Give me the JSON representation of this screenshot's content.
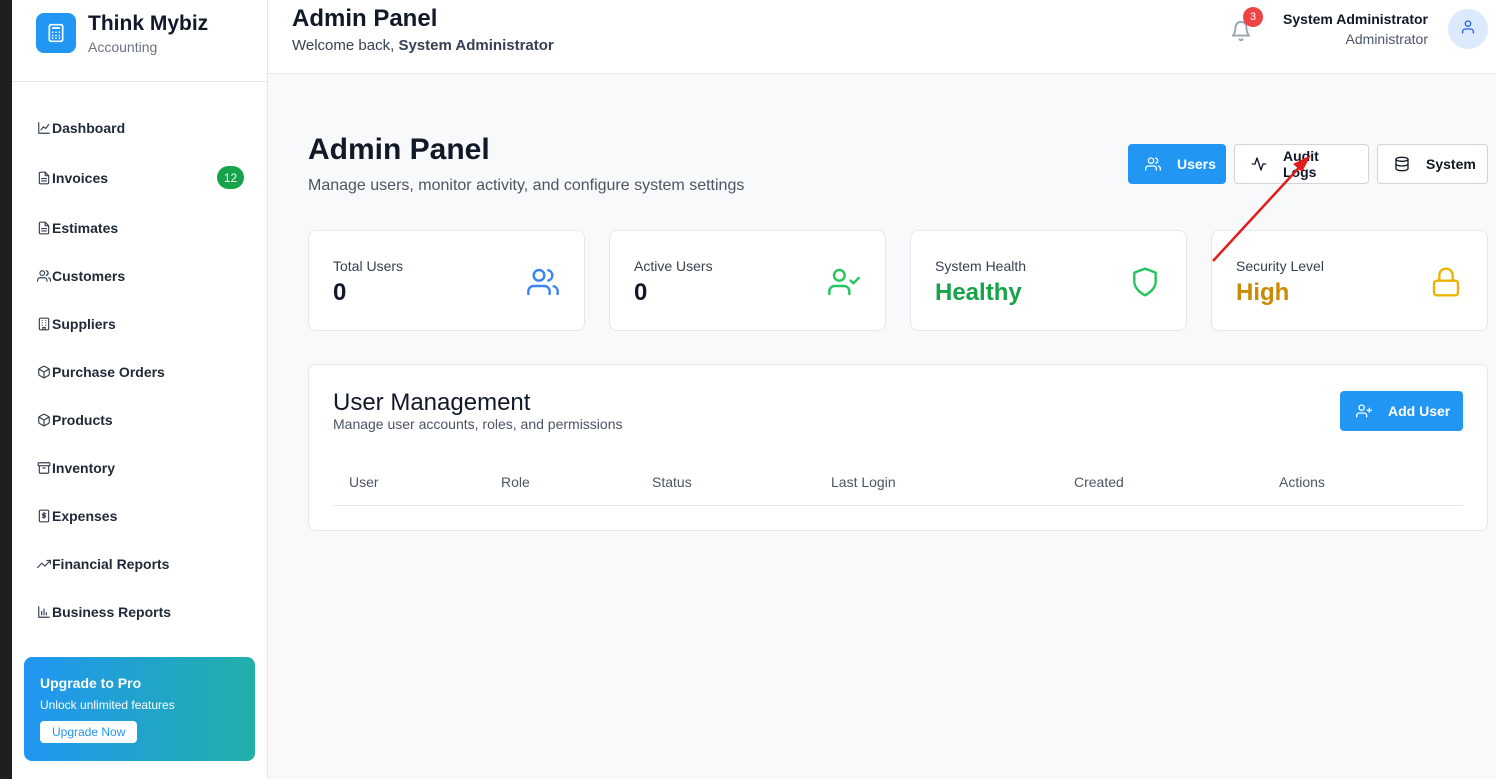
{
  "brand": {
    "name": "Think Mybiz",
    "subtitle": "Accounting"
  },
  "sidebar": {
    "items": [
      {
        "label": "Dashboard",
        "icon": "line-chart-icon"
      },
      {
        "label": "Invoices",
        "icon": "file-text-icon",
        "badge": "12"
      },
      {
        "label": "Estimates",
        "icon": "file-text-icon"
      },
      {
        "label": "Customers",
        "icon": "users-icon"
      },
      {
        "label": "Suppliers",
        "icon": "building-icon"
      },
      {
        "label": "Purchase Orders",
        "icon": "package-icon"
      },
      {
        "label": "Products",
        "icon": "package-icon"
      },
      {
        "label": "Inventory",
        "icon": "archive-icon"
      },
      {
        "label": "Expenses",
        "icon": "dollar-receipt-icon"
      },
      {
        "label": "Financial Reports",
        "icon": "trending-up-icon"
      },
      {
        "label": "Business Reports",
        "icon": "bar-chart-icon"
      }
    ],
    "upgrade": {
      "title": "Upgrade to Pro",
      "subtitle": "Unlock unlimited features",
      "button": "Upgrade Now"
    }
  },
  "header": {
    "title": "Admin Panel",
    "welcome_prefix": "Welcome back,",
    "welcome_name": "System Administrator",
    "notifications_count": "3",
    "user_name": "System Administrator",
    "user_role": "Administrator"
  },
  "main": {
    "title": "Admin Panel",
    "subtitle": "Manage users, monitor activity, and configure system settings",
    "tabs": [
      {
        "label": "Users",
        "icon": "users-icon",
        "active": true
      },
      {
        "label": "Audit Logs",
        "icon": "activity-icon",
        "active": false
      },
      {
        "label": "System",
        "icon": "database-icon",
        "active": false
      }
    ],
    "stats": [
      {
        "label": "Total Users",
        "value": "0",
        "icon": "users-icon",
        "color": "#3b82f6"
      },
      {
        "label": "Active Users",
        "value": "0",
        "icon": "user-check-icon",
        "color": "#22c55e"
      },
      {
        "label": "System Health",
        "value": "Healthy",
        "icon": "shield-icon",
        "color": "#16a34a"
      },
      {
        "label": "Security Level",
        "value": "High",
        "icon": "lock-icon",
        "color": "#ca8a04"
      }
    ],
    "user_management": {
      "title": "User Management",
      "subtitle": "Manage user accounts, roles, and permissions",
      "add_button": "Add User",
      "columns": [
        "User",
        "Role",
        "Status",
        "Last Login",
        "Created",
        "Actions"
      ]
    }
  },
  "colors": {
    "primary": "#2196f3",
    "success": "#16a34a",
    "warning": "#ca8a04",
    "danger": "#ef4444",
    "annotation_arrow": "#e11d1d"
  }
}
